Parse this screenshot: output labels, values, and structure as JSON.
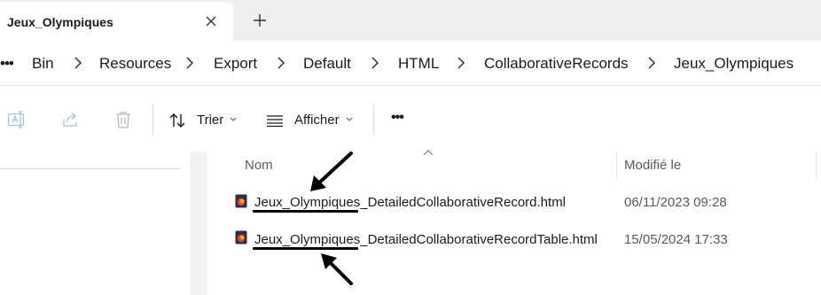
{
  "tab": {
    "title": "Jeux_Olympiques"
  },
  "breadcrumb": {
    "overflow": "•••",
    "items": [
      "Bin",
      "Resources",
      "Export",
      "Default",
      "HTML",
      "CollaborativeRecords",
      "Jeux_Olympiques"
    ]
  },
  "toolbar": {
    "sort_label": "Trier",
    "view_label": "Afficher",
    "more_label": "•••"
  },
  "columns": {
    "name": "Nom",
    "modified": "Modifié le"
  },
  "files": [
    {
      "prefix": "Jeux_Olympiques",
      "rest": "_DetailedCollaborativeRecord.html",
      "modified": "06/11/2023 09:28"
    },
    {
      "prefix": "Jeux_Olympiques",
      "rest": "_DetailedCollaborativeRecordTable.html",
      "modified": "15/05/2024 17:33"
    }
  ],
  "icons": {
    "tab_close": "close-icon",
    "new_tab": "plus-icon",
    "breadcrumb_separator": "chevron-right-icon",
    "rename": "rename-icon",
    "share": "share-icon",
    "delete": "trash-icon",
    "sort": "sort-arrows-icon",
    "view": "view-lines-icon",
    "file": "html-file-icon"
  },
  "colors": {
    "tabstrip": "#eeeeee",
    "annotation": "#000000",
    "file_icon": "#e8461f"
  }
}
